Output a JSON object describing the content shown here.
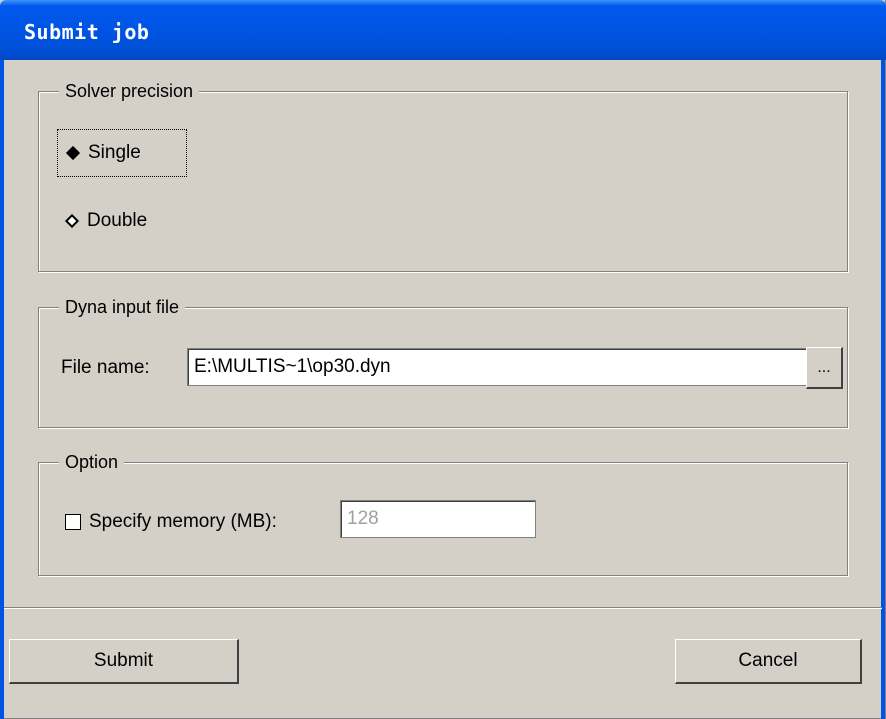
{
  "window": {
    "title": "Submit job"
  },
  "solver_precision": {
    "legend": "Solver precision",
    "options": [
      {
        "label": "Single",
        "selected": true
      },
      {
        "label": "Double",
        "selected": false
      }
    ]
  },
  "input_file": {
    "legend": "Dyna input file",
    "file_label": "File name:",
    "file_value": "E:\\MULTIS~1\\op30.dyn",
    "browse_label": "..."
  },
  "option": {
    "legend": "Option",
    "memory_label": "Specify memory (MB):",
    "memory_checked": false,
    "memory_value": "128"
  },
  "buttons": {
    "submit": "Submit",
    "cancel": "Cancel"
  }
}
